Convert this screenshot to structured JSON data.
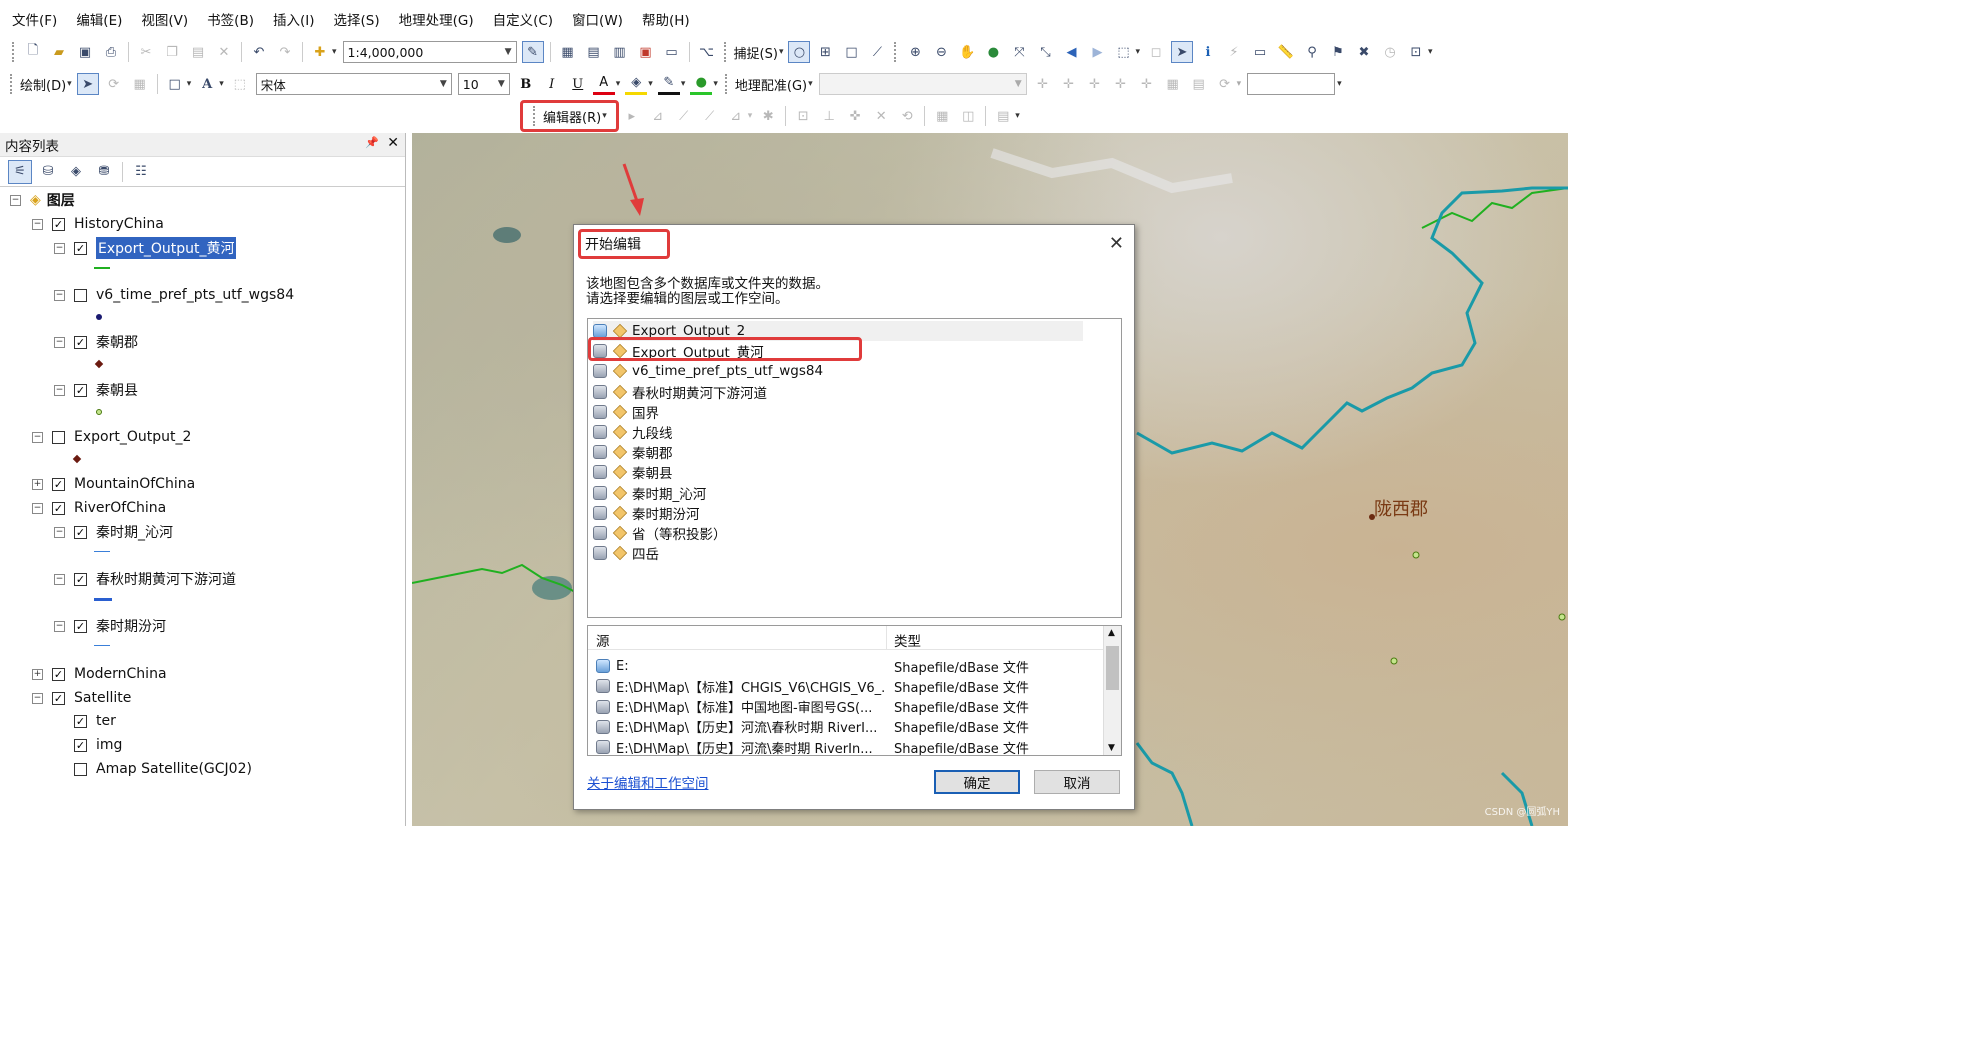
{
  "menu": [
    "文件(F)",
    "编辑(E)",
    "视图(V)",
    "书签(B)",
    "插入(I)",
    "选择(S)",
    "地理处理(G)",
    "自定义(C)",
    "窗口(W)",
    "帮助(H)"
  ],
  "toolbar1": {
    "scale": "1:4,000,000",
    "snapping_label": "捕捉(S)"
  },
  "toolbar2": {
    "draw_label": "绘制(D)",
    "font": "宋体",
    "font_size": "10",
    "bold": "B",
    "italic": "I",
    "underline": "U",
    "text_tool": "A",
    "georef_label": "地理配准(G)"
  },
  "toolbar3": {
    "editor_label": "编辑器(R)"
  },
  "toc": {
    "title": "内容列表",
    "root": "图层",
    "layers": [
      {
        "label": "HistoryChina",
        "checked": true,
        "level": 1,
        "expander": "⊟"
      },
      {
        "label": "Export_Output_黄河",
        "checked": true,
        "level": 2,
        "expander": "⊟",
        "selected": true
      },
      {
        "label": "v6_time_pref_pts_utf_wgs84",
        "checked": false,
        "level": 2,
        "expander": "⊟"
      },
      {
        "label": "秦朝郡",
        "checked": true,
        "level": 2,
        "expander": "⊟"
      },
      {
        "label": "秦朝县",
        "checked": true,
        "level": 2,
        "expander": "⊟"
      },
      {
        "label": "Export_Output_2",
        "checked": false,
        "level": 1,
        "expander": "⊟"
      },
      {
        "label": "MountainOfChina",
        "checked": true,
        "level": 1,
        "expander": "⊞"
      },
      {
        "label": "RiverOfChina",
        "checked": true,
        "level": 1,
        "expander": "⊟"
      },
      {
        "label": "秦时期_沁河",
        "checked": true,
        "level": 2,
        "expander": "⊟"
      },
      {
        "label": "春秋时期黄河下游河道",
        "checked": true,
        "level": 2,
        "expander": "⊟"
      },
      {
        "label": "秦时期汾河",
        "checked": true,
        "level": 2,
        "expander": "⊟"
      },
      {
        "label": "ModernChina",
        "checked": true,
        "level": 1,
        "expander": "⊞"
      },
      {
        "label": "Satellite",
        "checked": true,
        "level": 1,
        "expander": "⊟"
      },
      {
        "label": "ter",
        "checked": true,
        "level": 2,
        "expander": ""
      },
      {
        "label": "img",
        "checked": true,
        "level": 2,
        "expander": ""
      },
      {
        "label": "Amap Satellite(GCJ02)",
        "checked": false,
        "level": 2,
        "expander": ""
      }
    ]
  },
  "map": {
    "label": "陇西郡",
    "watermark": "CSDN @圆弧YH"
  },
  "dialog": {
    "title": "开始编辑",
    "message_line1": "该地图包含多个数据库或文件夹的数据。",
    "message_line2": "请选择要编辑的图层或工作空间。",
    "workspaces": [
      {
        "label": "Export_Output_2",
        "folder": true
      },
      {
        "label": "Export_Output_黄河",
        "folder": false
      },
      {
        "label": "v6_time_pref_pts_utf_wgs84",
        "folder": false
      },
      {
        "label": "春秋时期黄河下游河道",
        "folder": false
      },
      {
        "label": "国界",
        "folder": false
      },
      {
        "label": "九段线",
        "folder": false
      },
      {
        "label": "秦朝郡",
        "folder": false
      },
      {
        "label": "秦朝县",
        "folder": false
      },
      {
        "label": "秦时期_沁河",
        "folder": false
      },
      {
        "label": "秦时期汾河",
        "folder": false
      },
      {
        "label": "省（等积投影）",
        "folder": false
      },
      {
        "label": "四岳",
        "folder": false
      }
    ],
    "source_header": "源",
    "type_header": "类型",
    "sources": [
      {
        "src": "E:",
        "type": "Shapefile/dBase 文件",
        "folder": true
      },
      {
        "src": "E:\\DH\\Map\\【标准】CHGIS_V6\\CHGIS_V6_...",
        "type": "Shapefile/dBase 文件",
        "folder": false
      },
      {
        "src": "E:\\DH\\Map\\【标准】中国地图-审图号GS(...",
        "type": "Shapefile/dBase 文件",
        "folder": false
      },
      {
        "src": "E:\\DH\\Map\\【历史】河流\\春秋时期 RiverI...",
        "type": "Shapefile/dBase 文件",
        "folder": false
      },
      {
        "src": "E:\\DH\\Map\\【历史】河流\\秦时期 RiverIn...",
        "type": "Shapefile/dBase 文件",
        "folder": false
      }
    ],
    "help_link": "关于编辑和工作空间",
    "ok": "确定",
    "cancel": "取消"
  },
  "colors": {
    "highlight": "#e03b3b",
    "selection": "#3164c0",
    "river": "#1a9aa8",
    "link": "#1a4fd1"
  }
}
